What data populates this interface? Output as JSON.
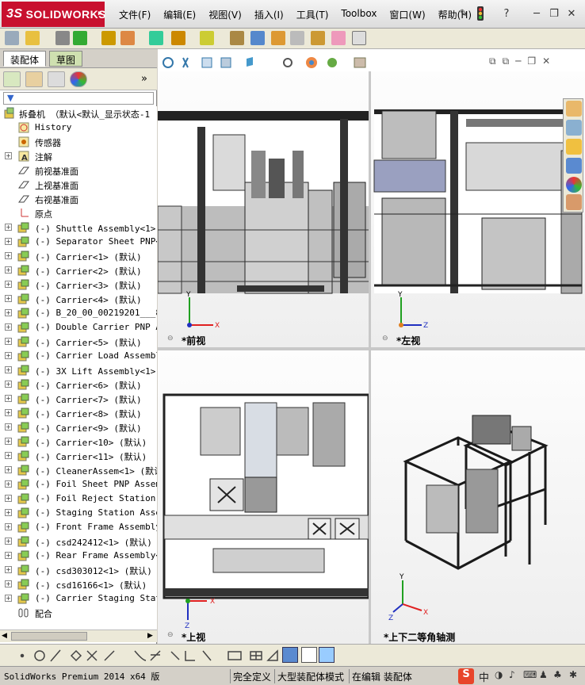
{
  "app": {
    "logo_prefix": "3S",
    "logo_text": "SOLIDWORKS",
    "logo_arrow": "▸"
  },
  "menu": [
    "文件(F)",
    "编辑(E)",
    "视图(V)",
    "插入(I)",
    "工具(T)",
    "Toolbox",
    "窗口(W)",
    "帮助(H)"
  ],
  "window_controls": {
    "minimize": "─",
    "restore": "❐",
    "close": "✕",
    "help": "?"
  },
  "left_tabs": {
    "assembly": "装配体",
    "sketch": "草图"
  },
  "feature_manager": {
    "expand_more": "»",
    "root": "拆叠机 （默认<默认_显示状态-1",
    "items": [
      {
        "label": "History",
        "icon": "history-icon",
        "expander": false
      },
      {
        "label": "传感器",
        "icon": "sensor-icon",
        "expander": false
      },
      {
        "label": "注解",
        "icon": "annotation-icon",
        "expander": true
      },
      {
        "label": "前视基准面",
        "icon": "plane-icon",
        "expander": false
      },
      {
        "label": "上视基准面",
        "icon": "plane-icon",
        "expander": false
      },
      {
        "label": "右视基准面",
        "icon": "plane-icon",
        "expander": false
      },
      {
        "label": "原点",
        "icon": "origin-icon",
        "expander": false
      },
      {
        "label": "(-) Shuttle Assembly<1> (默",
        "icon": "subassembly-icon",
        "expander": true
      },
      {
        "label": "(-) Separator Sheet PNP<1>",
        "icon": "subassembly-icon",
        "expander": true
      },
      {
        "label": "(-) Carrier<1> (默认)",
        "icon": "subassembly-icon",
        "expander": true
      },
      {
        "label": "(-) Carrier<2> (默认)",
        "icon": "subassembly-icon",
        "expander": true
      },
      {
        "label": "(-) Carrier<3> (默认)",
        "icon": "subassembly-icon",
        "expander": true
      },
      {
        "label": "(-) Carrier<4> (默认)",
        "icon": "subassembly-icon",
        "expander": true
      },
      {
        "label": "(-) B_20_00_00219201___850",
        "icon": "subassembly-icon",
        "expander": true
      },
      {
        "label": "(-) Double Carrier PNP As",
        "icon": "subassembly-icon",
        "expander": true
      },
      {
        "label": "(-) Carrier<5> (默认)",
        "icon": "subassembly-icon",
        "expander": true
      },
      {
        "label": "(-) Carrier Load Assembly",
        "icon": "subassembly-icon",
        "expander": true
      },
      {
        "label": "(-) 3X Lift Assembly<1> (默",
        "icon": "subassembly-icon",
        "expander": true
      },
      {
        "label": "(-) Carrier<6> (默认)",
        "icon": "subassembly-icon",
        "expander": true
      },
      {
        "label": "(-) Carrier<7> (默认)",
        "icon": "subassembly-icon",
        "expander": true
      },
      {
        "label": "(-) Carrier<8> (默认)",
        "icon": "subassembly-icon",
        "expander": true
      },
      {
        "label": "(-) Carrier<9> (默认)",
        "icon": "subassembly-icon",
        "expander": true
      },
      {
        "label": "(-) Carrier<10> (默认)",
        "icon": "subassembly-icon",
        "expander": true
      },
      {
        "label": "(-) Carrier<11> (默认)",
        "icon": "subassembly-icon",
        "expander": true
      },
      {
        "label": "(-) CleanerAssem<1> (默认)",
        "icon": "subassembly-icon",
        "expander": true
      },
      {
        "label": "(-) Foil Sheet PNP Assembl",
        "icon": "subassembly-icon",
        "expander": true
      },
      {
        "label": "(-) Foil Reject Station As",
        "icon": "subassembly-icon",
        "expander": true
      },
      {
        "label": "(-) Staging Station Assemb",
        "icon": "subassembly-icon",
        "expander": true
      },
      {
        "label": "(-) Front Frame Assembly<1",
        "icon": "subassembly-icon",
        "expander": true
      },
      {
        "label": "(-) csd242412<1> (默认)",
        "icon": "subassembly-icon",
        "expander": true
      },
      {
        "label": "(-) Rear Frame Assembly<1>",
        "icon": "subassembly-icon",
        "expander": true
      },
      {
        "label": "(-) csd303012<1> (默认)",
        "icon": "subassembly-icon",
        "expander": true
      },
      {
        "label": "(-) csd16166<1> (默认)",
        "icon": "subassembly-icon",
        "expander": true
      },
      {
        "label": "(-) Carrier Staging Statio",
        "icon": "subassembly-icon",
        "expander": true
      },
      {
        "label": "配合",
        "icon": "mates-icon",
        "expander": false
      }
    ]
  },
  "viewports": {
    "front": "*前视",
    "left": "*左视",
    "top": "*上视",
    "iso": "*上下二等角轴测"
  },
  "axis": {
    "x": "X",
    "y": "Y",
    "z": "Z"
  },
  "status": {
    "product": "SolidWorks Premium 2014 x64 版",
    "define": "完全定义",
    "mode": "大型装配体模式",
    "editing": "在编辑 装配体"
  },
  "ime": {
    "logo": "S",
    "lang": "中"
  },
  "colors": {
    "brand": "#c8102e",
    "axis_x": "#e02020",
    "axis_y": "#20a020",
    "axis_z": "#2030c0"
  }
}
